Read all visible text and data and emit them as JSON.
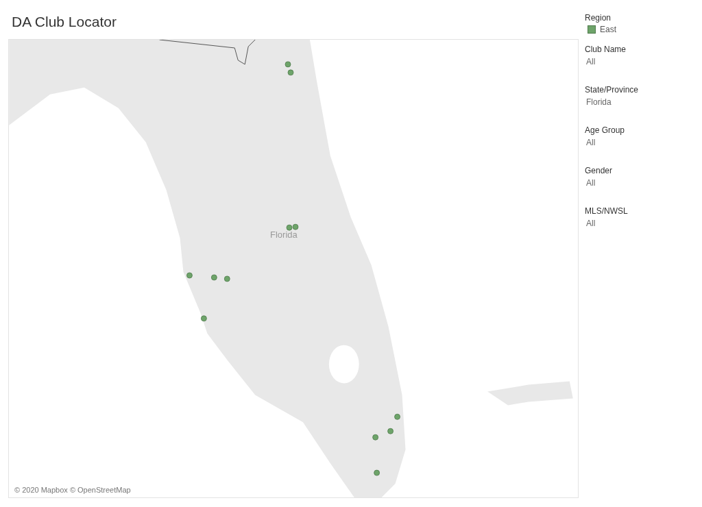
{
  "title": "DA Club Locator",
  "map": {
    "label": "Florida",
    "attribution": "© 2020 Mapbox © OpenStreetMap"
  },
  "legend": {
    "title": "Region",
    "items": [
      {
        "label": "East",
        "color": "#6ea46a"
      }
    ]
  },
  "filters": [
    {
      "label": "Club Name",
      "value": "All"
    },
    {
      "label": "State/Province",
      "value": "Florida"
    },
    {
      "label": "Age Group",
      "value": "All"
    },
    {
      "label": "Gender",
      "value": "All"
    },
    {
      "label": "MLS/NWSL",
      "value": "All"
    }
  ]
}
